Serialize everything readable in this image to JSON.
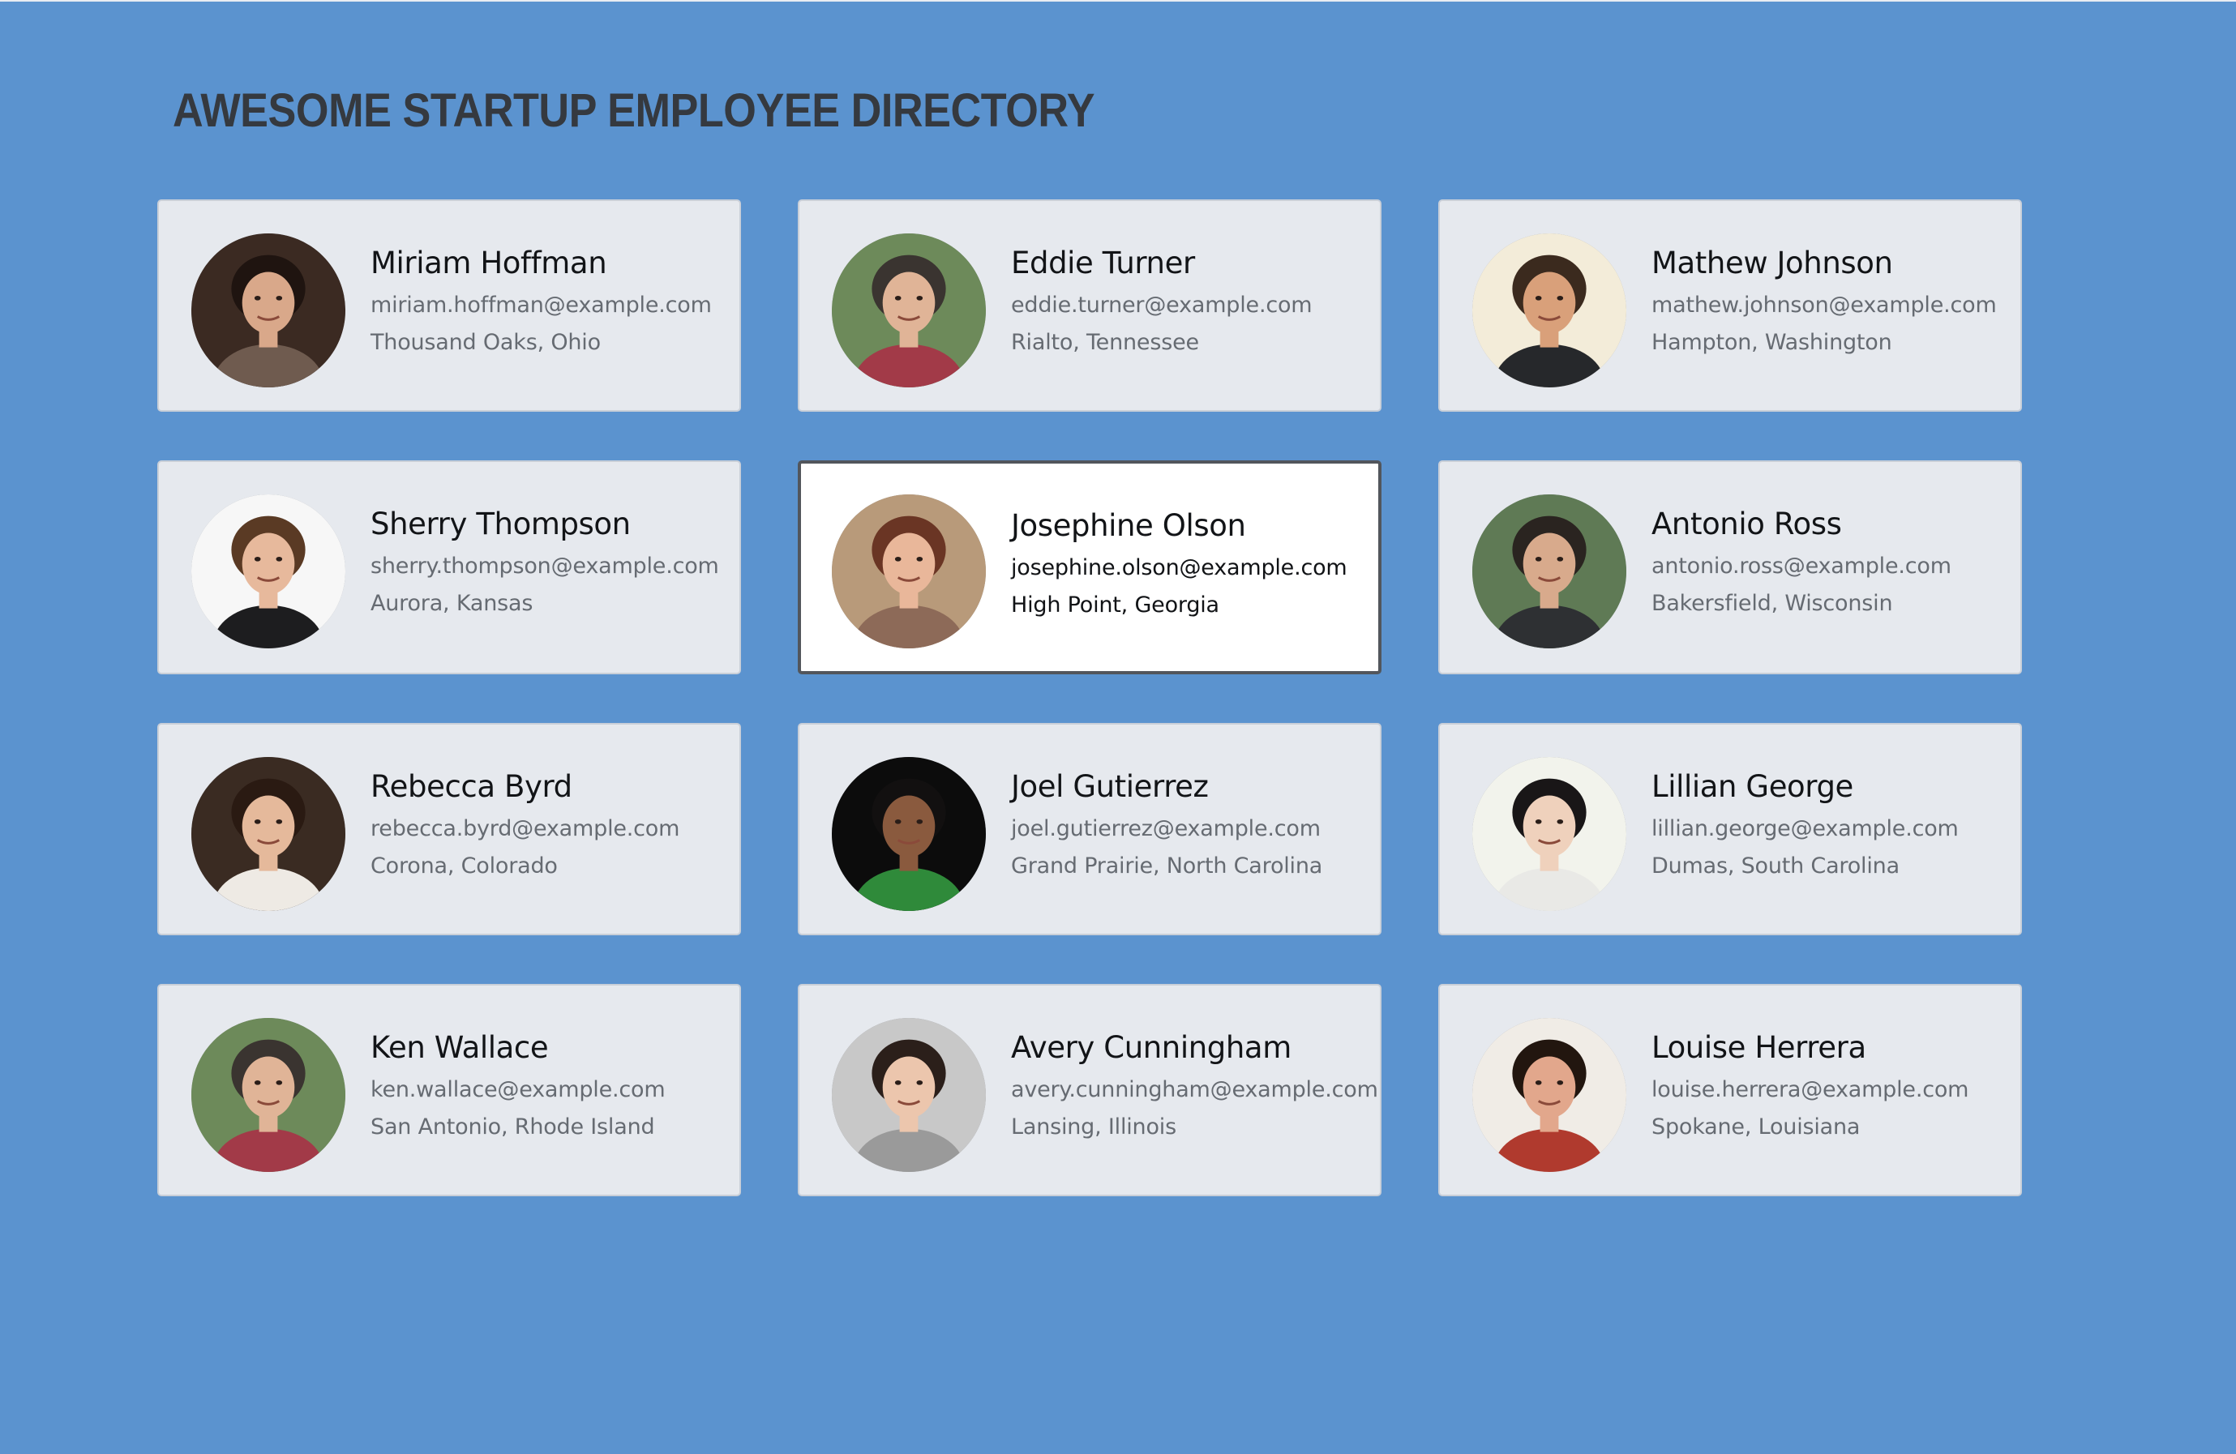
{
  "page": {
    "title": "AWESOME STARTUP EMPLOYEE DIRECTORY",
    "background_color": "#5b93cf",
    "card_color": "#e6e9ee",
    "selected_card_color": "#ffffff"
  },
  "employees": [
    {
      "name": "Miriam Hoffman",
      "email": "miriam.hoffman@example.com",
      "location": "Thousand Oaks, Ohio",
      "selected": false,
      "avatar": {
        "bg": "#3b2a22",
        "skin": "#d9a88a",
        "hair": "#1f1410",
        "shirt": "#6f5b4f"
      }
    },
    {
      "name": "Eddie Turner",
      "email": "eddie.turner@example.com",
      "location": "Rialto, Tennessee",
      "selected": false,
      "avatar": {
        "bg": "#6d8a5a",
        "skin": "#e0b497",
        "hair": "#3a3430",
        "shirt": "#a23a48"
      }
    },
    {
      "name": "Mathew Johnson",
      "email": "mathew.johnson@example.com",
      "location": "Hampton, Washington",
      "selected": false,
      "avatar": {
        "bg": "#f3ecd9",
        "skin": "#d9a07a",
        "hair": "#3b2a1e",
        "shirt": "#26282b"
      }
    },
    {
      "name": "Sherry Thompson",
      "email": "sherry.thompson@example.com",
      "location": "Aurora, Kansas",
      "selected": false,
      "avatar": {
        "bg": "#f7f7f7",
        "skin": "#e7b99c",
        "hair": "#5a3a24",
        "shirt": "#1d1d1f"
      }
    },
    {
      "name": "Josephine Olson",
      "email": "josephine.olson@example.com",
      "location": "High Point, Georgia",
      "selected": true,
      "avatar": {
        "bg": "#b89a7a",
        "skin": "#e9b79a",
        "hair": "#6a3524",
        "shirt": "#8d6a58"
      }
    },
    {
      "name": "Antonio Ross",
      "email": "antonio.ross@example.com",
      "location": "Bakersfield, Wisconsin",
      "selected": false,
      "avatar": {
        "bg": "#5f7a55",
        "skin": "#d8aa8c",
        "hair": "#2a2420",
        "shirt": "#2e3033"
      }
    },
    {
      "name": "Rebecca Byrd",
      "email": "rebecca.byrd@example.com",
      "location": "Corona, Colorado",
      "selected": false,
      "avatar": {
        "bg": "#3a2b22",
        "skin": "#e5b99b",
        "hair": "#2a1a12",
        "shirt": "#eeeae4"
      }
    },
    {
      "name": "Joel Gutierrez",
      "email": "joel.gutierrez@example.com",
      "location": "Grand Prairie, North Carolina",
      "selected": false,
      "avatar": {
        "bg": "#0c0c0c",
        "skin": "#8a5a3e",
        "hair": "#121010",
        "shirt": "#2f8a3a"
      }
    },
    {
      "name": "Lillian George",
      "email": "lillian.george@example.com",
      "location": "Dumas, South Carolina",
      "selected": false,
      "avatar": {
        "bg": "#f2f3ec",
        "skin": "#efd1bc",
        "hair": "#191617",
        "shirt": "#e9e9e6"
      }
    },
    {
      "name": "Ken Wallace",
      "email": "ken.wallace@example.com",
      "location": "San Antonio, Rhode Island",
      "selected": false,
      "avatar": {
        "bg": "#6d8a5a",
        "skin": "#e0b497",
        "hair": "#3a3430",
        "shirt": "#a23a48"
      }
    },
    {
      "name": "Avery Cunningham",
      "email": "avery.cunningham@example.com",
      "location": "Lansing, Illinois",
      "selected": false,
      "avatar": {
        "bg": "#c8c8c8",
        "skin": "#ecc6ad",
        "hair": "#2b1f1a",
        "shirt": "#9a9a9a"
      }
    },
    {
      "name": "Louise Herrera",
      "email": "louise.herrera@example.com",
      "location": "Spokane, Louisiana",
      "selected": false,
      "avatar": {
        "bg": "#f0ece6",
        "skin": "#e2a78c",
        "hair": "#22160f",
        "shirt": "#b03a2e"
      }
    }
  ]
}
